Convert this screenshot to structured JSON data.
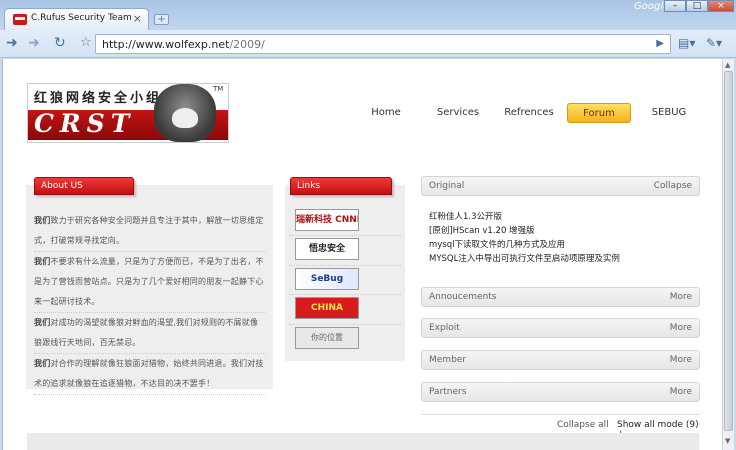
{
  "browser": {
    "tab_title": "C.Rufus Security Team - □...",
    "tab_close": "×",
    "new_tab": "+",
    "brand": "Google",
    "window_buttons": {
      "minimize": "–",
      "maximize": "□",
      "close": "×"
    },
    "url_host": "http://www.wolfexp.net",
    "url_path": "/2009/"
  },
  "logo": {
    "cn_text": "红狼网络安全小组",
    "crst_text": "CRST",
    "tm": "TM"
  },
  "nav": {
    "items": [
      "Home",
      "Services",
      "Refrences",
      "Forum",
      "SEBUG"
    ],
    "active": "Forum",
    "active_color": "#f4b21d"
  },
  "about": {
    "title": "About US",
    "paragraphs": [
      {
        "lead": "我们",
        "text": "致力于研究各种安全问题并且专注于其中，解放一切思维定式，打破常规寻找定向。"
      },
      {
        "lead": "我们",
        "text": "不要求有什么流量，只是为了方便而已，不是为了出名，不是为了营钱而营站点。只是为了几个爱好相同的朋友一起静下心来一起研讨技术。"
      },
      {
        "lead": "我们",
        "text": "对成功的渴望就像狼对鲜血的渴望,我们对规则的不屑就像狼跟线行天地间，百无禁忌。"
      },
      {
        "lead": "我们",
        "text": "对合作的理解就像狂狼面对猎物，始终共同进退。我们对技术的追求就像狼在追逐猎物，不达目的决不罢手！"
      }
    ],
    "accent_color": "#d41616"
  },
  "links": {
    "title": "Links",
    "items": [
      "瑞新科技 CNNN.CC",
      "悟忠安全",
      "SeBug",
      "CHINA",
      "你的位置"
    ]
  },
  "right_panel": {
    "original": {
      "title": "Original",
      "action": "Collapse",
      "items": [
        "红粉佳人1.3公开版",
        "[原创]HScan v1.20 增强版",
        "mysql下读取文件的几种方式及应用",
        "MYSQL注入中导出可执行文件至启动项原理及实例"
      ]
    },
    "sections": [
      {
        "title": "Annoucements",
        "action": "More"
      },
      {
        "title": "Exploit",
        "action": "More"
      },
      {
        "title": "Member",
        "action": "More"
      },
      {
        "title": "Partners",
        "action": "More"
      }
    ],
    "collapse_all": "Collapse all",
    "show_all": "Show all mode (9)"
  }
}
